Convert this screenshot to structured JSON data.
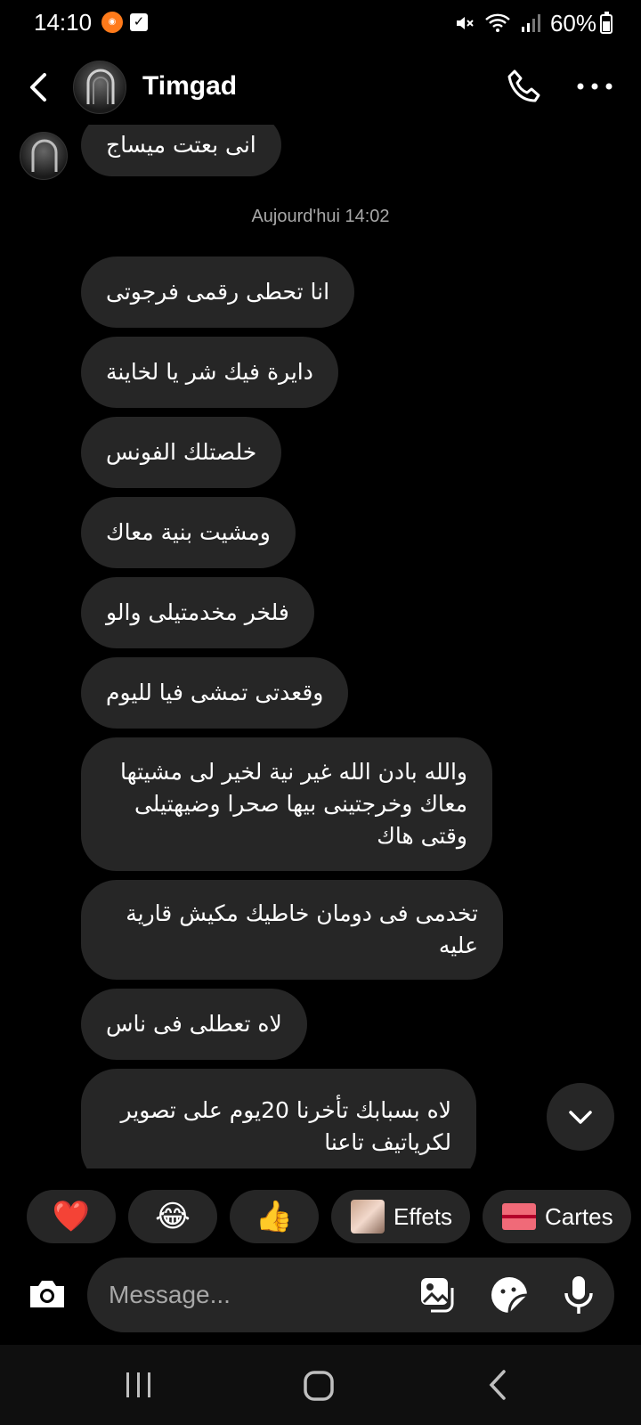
{
  "status_bar": {
    "time": "14:10",
    "battery": "60%"
  },
  "header": {
    "contact_name": "Timgad"
  },
  "thread": {
    "previous_message": "انی بعتت میساج",
    "timestamp": "Aujourd'hui 14:02",
    "messages": [
      "انا تحطى رقمى فرجوتى",
      "دايرة فيك شر يا لخاينة",
      "خلصتلك الفونس",
      "ومشيت بنية معاك",
      "فلخر مخدمتيلى والو",
      "وقعدتى تمشى فيا لليوم",
      "والله بادن الله غير نية لخير لى مشيتها معاك وخرجتينى بيها صحرا وضيهتيلى وقتى هاك",
      "تخدمى فى دومان خاطيك مكيش قارية عليه",
      "لاه تعطلى فى ناس",
      "لاه بسبابك تأخرنا 20يوم على تصوير لكرياتيف تاعنا"
    ]
  },
  "reactions": {
    "heart": "❤️",
    "laugh": "😂",
    "thumbs_up": "👍",
    "effets_label": "Effets",
    "cartes_label": "Cartes"
  },
  "composer": {
    "placeholder": "Message..."
  }
}
